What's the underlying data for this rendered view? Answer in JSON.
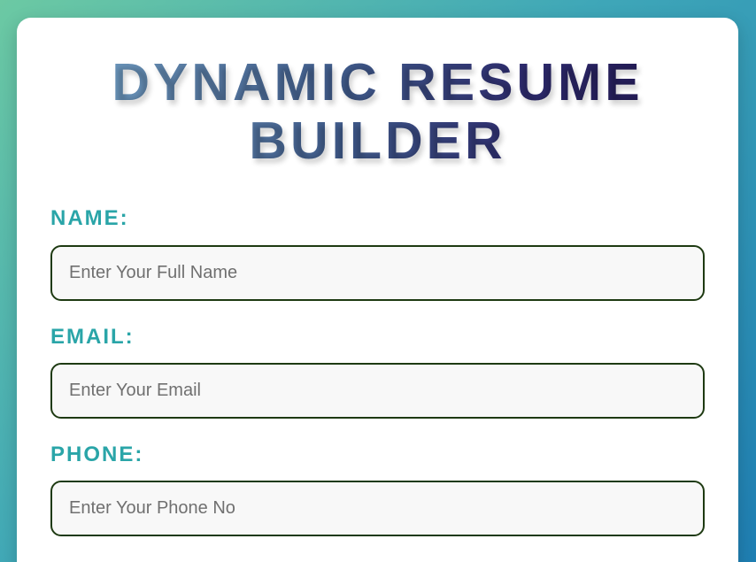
{
  "form": {
    "title": "DYNAMIC RESUME BUILDER",
    "fields": [
      {
        "label": "NAME:",
        "placeholder": "Enter Your Full Name",
        "value": ""
      },
      {
        "label": "EMAIL:",
        "placeholder": "Enter Your Email",
        "value": ""
      },
      {
        "label": "PHONE:",
        "placeholder": "Enter Your Phone No",
        "value": ""
      }
    ]
  },
  "colors": {
    "background_gradient": [
      "#6cc9a3",
      "#3fa7b8",
      "#1f7fb3"
    ],
    "label": "#2aa5a8",
    "input_border": "#1e3a12",
    "input_background": "#f8f8f8",
    "title_gradient": [
      "#7fb3d6",
      "#3f5a89",
      "#1c0f45"
    ]
  }
}
